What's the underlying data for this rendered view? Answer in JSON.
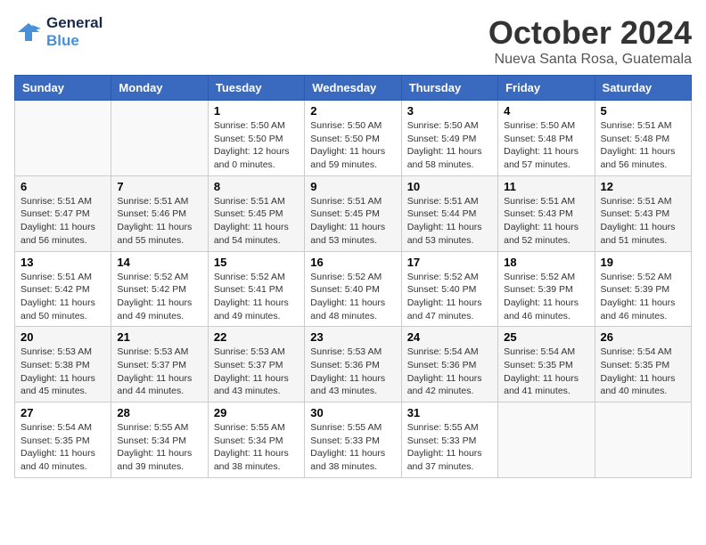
{
  "logo": {
    "line1": "General",
    "line2": "Blue"
  },
  "title": "October 2024",
  "location": "Nueva Santa Rosa, Guatemala",
  "days_header": [
    "Sunday",
    "Monday",
    "Tuesday",
    "Wednesday",
    "Thursday",
    "Friday",
    "Saturday"
  ],
  "weeks": [
    [
      {
        "day": "",
        "info": ""
      },
      {
        "day": "",
        "info": ""
      },
      {
        "day": "1",
        "info": "Sunrise: 5:50 AM\nSunset: 5:50 PM\nDaylight: 12 hours and 0 minutes."
      },
      {
        "day": "2",
        "info": "Sunrise: 5:50 AM\nSunset: 5:50 PM\nDaylight: 11 hours and 59 minutes."
      },
      {
        "day": "3",
        "info": "Sunrise: 5:50 AM\nSunset: 5:49 PM\nDaylight: 11 hours and 58 minutes."
      },
      {
        "day": "4",
        "info": "Sunrise: 5:50 AM\nSunset: 5:48 PM\nDaylight: 11 hours and 57 minutes."
      },
      {
        "day": "5",
        "info": "Sunrise: 5:51 AM\nSunset: 5:48 PM\nDaylight: 11 hours and 56 minutes."
      }
    ],
    [
      {
        "day": "6",
        "info": "Sunrise: 5:51 AM\nSunset: 5:47 PM\nDaylight: 11 hours and 56 minutes."
      },
      {
        "day": "7",
        "info": "Sunrise: 5:51 AM\nSunset: 5:46 PM\nDaylight: 11 hours and 55 minutes."
      },
      {
        "day": "8",
        "info": "Sunrise: 5:51 AM\nSunset: 5:45 PM\nDaylight: 11 hours and 54 minutes."
      },
      {
        "day": "9",
        "info": "Sunrise: 5:51 AM\nSunset: 5:45 PM\nDaylight: 11 hours and 53 minutes."
      },
      {
        "day": "10",
        "info": "Sunrise: 5:51 AM\nSunset: 5:44 PM\nDaylight: 11 hours and 53 minutes."
      },
      {
        "day": "11",
        "info": "Sunrise: 5:51 AM\nSunset: 5:43 PM\nDaylight: 11 hours and 52 minutes."
      },
      {
        "day": "12",
        "info": "Sunrise: 5:51 AM\nSunset: 5:43 PM\nDaylight: 11 hours and 51 minutes."
      }
    ],
    [
      {
        "day": "13",
        "info": "Sunrise: 5:51 AM\nSunset: 5:42 PM\nDaylight: 11 hours and 50 minutes."
      },
      {
        "day": "14",
        "info": "Sunrise: 5:52 AM\nSunset: 5:42 PM\nDaylight: 11 hours and 49 minutes."
      },
      {
        "day": "15",
        "info": "Sunrise: 5:52 AM\nSunset: 5:41 PM\nDaylight: 11 hours and 49 minutes."
      },
      {
        "day": "16",
        "info": "Sunrise: 5:52 AM\nSunset: 5:40 PM\nDaylight: 11 hours and 48 minutes."
      },
      {
        "day": "17",
        "info": "Sunrise: 5:52 AM\nSunset: 5:40 PM\nDaylight: 11 hours and 47 minutes."
      },
      {
        "day": "18",
        "info": "Sunrise: 5:52 AM\nSunset: 5:39 PM\nDaylight: 11 hours and 46 minutes."
      },
      {
        "day": "19",
        "info": "Sunrise: 5:52 AM\nSunset: 5:39 PM\nDaylight: 11 hours and 46 minutes."
      }
    ],
    [
      {
        "day": "20",
        "info": "Sunrise: 5:53 AM\nSunset: 5:38 PM\nDaylight: 11 hours and 45 minutes."
      },
      {
        "day": "21",
        "info": "Sunrise: 5:53 AM\nSunset: 5:37 PM\nDaylight: 11 hours and 44 minutes."
      },
      {
        "day": "22",
        "info": "Sunrise: 5:53 AM\nSunset: 5:37 PM\nDaylight: 11 hours and 43 minutes."
      },
      {
        "day": "23",
        "info": "Sunrise: 5:53 AM\nSunset: 5:36 PM\nDaylight: 11 hours and 43 minutes."
      },
      {
        "day": "24",
        "info": "Sunrise: 5:54 AM\nSunset: 5:36 PM\nDaylight: 11 hours and 42 minutes."
      },
      {
        "day": "25",
        "info": "Sunrise: 5:54 AM\nSunset: 5:35 PM\nDaylight: 11 hours and 41 minutes."
      },
      {
        "day": "26",
        "info": "Sunrise: 5:54 AM\nSunset: 5:35 PM\nDaylight: 11 hours and 40 minutes."
      }
    ],
    [
      {
        "day": "27",
        "info": "Sunrise: 5:54 AM\nSunset: 5:35 PM\nDaylight: 11 hours and 40 minutes."
      },
      {
        "day": "28",
        "info": "Sunrise: 5:55 AM\nSunset: 5:34 PM\nDaylight: 11 hours and 39 minutes."
      },
      {
        "day": "29",
        "info": "Sunrise: 5:55 AM\nSunset: 5:34 PM\nDaylight: 11 hours and 38 minutes."
      },
      {
        "day": "30",
        "info": "Sunrise: 5:55 AM\nSunset: 5:33 PM\nDaylight: 11 hours and 38 minutes."
      },
      {
        "day": "31",
        "info": "Sunrise: 5:55 AM\nSunset: 5:33 PM\nDaylight: 11 hours and 37 minutes."
      },
      {
        "day": "",
        "info": ""
      },
      {
        "day": "",
        "info": ""
      }
    ]
  ]
}
